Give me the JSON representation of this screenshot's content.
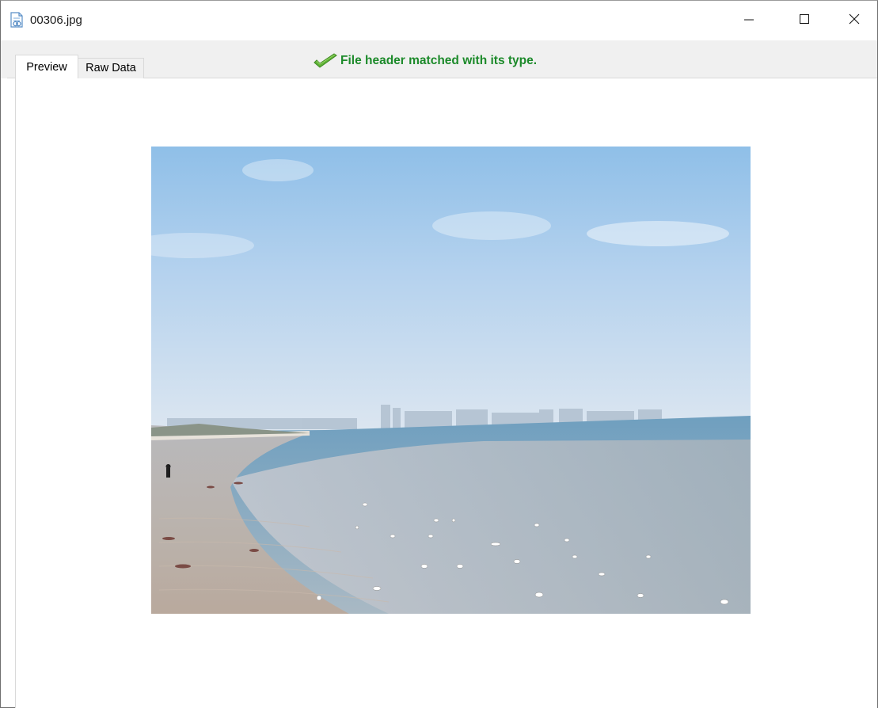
{
  "window": {
    "title": "00306.jpg",
    "icons": {
      "app": "image-file-icon",
      "minimize": "minimize-icon",
      "maximize": "maximize-icon",
      "close": "close-icon"
    }
  },
  "tabs": [
    {
      "label": "Preview",
      "active": true
    },
    {
      "label": "Raw Data",
      "active": false
    }
  ],
  "status": {
    "text": "File header matched with its type.",
    "icon": "checkmark-icon",
    "color": "#1c8a2a"
  },
  "preview": {
    "image_subject": "beach-seascape-photo"
  }
}
